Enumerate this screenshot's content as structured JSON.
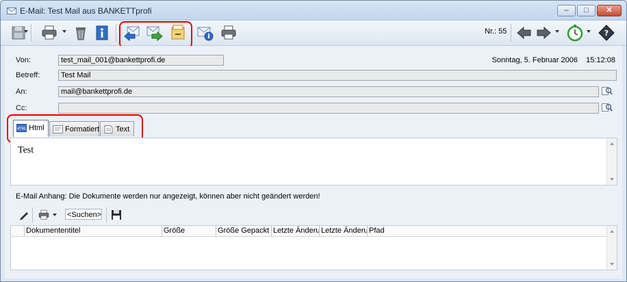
{
  "window": {
    "title": "E-Mail: Test Mail aus BANKETTprofi",
    "minimize": "–",
    "maximize": "□",
    "close": "✕"
  },
  "toolbar": {
    "nr_label": "Nr.: 55",
    "icons": [
      "save-icon",
      "print-icon",
      "trash-icon",
      "info-icon",
      "reply-icon",
      "forward-icon",
      "archive-icon",
      "mail-info-icon",
      "printer-icon",
      "prev-icon",
      "next-icon",
      "clock-icon",
      "help-icon"
    ]
  },
  "header": {
    "date_text": "Sonntag, 5. Februar 2006    15:12:08",
    "von_label": "Von:",
    "von_value": "test_mail_001@bankettprofi.de",
    "betreff_label": "Betreff:",
    "betreff_value": "Test Mail",
    "an_label": "An:",
    "an_value": "mail@bankettprofi.de",
    "cc_label": "Cc:",
    "cc_value": ""
  },
  "tabs": [
    {
      "label": "Html",
      "icon": "html-icon"
    },
    {
      "label": "Formatiert",
      "icon": "formatted-icon"
    },
    {
      "label": "Text",
      "icon": "text-icon"
    }
  ],
  "body": {
    "content": "Test"
  },
  "attachments": {
    "note": "E-Mail Anhang: Die Dokumente werden nur angezeigt, können aber nicht geändert werden!",
    "search_placeholder": "<Suchen>",
    "columns": [
      "Dokumententitel",
      "Größe",
      "Größe Gepackt",
      "Letzte Änderung",
      "Letzte Änderung",
      "Pfad"
    ]
  },
  "colors": {
    "highlight": "#e00000",
    "title_bar": "#c2d6ee"
  }
}
